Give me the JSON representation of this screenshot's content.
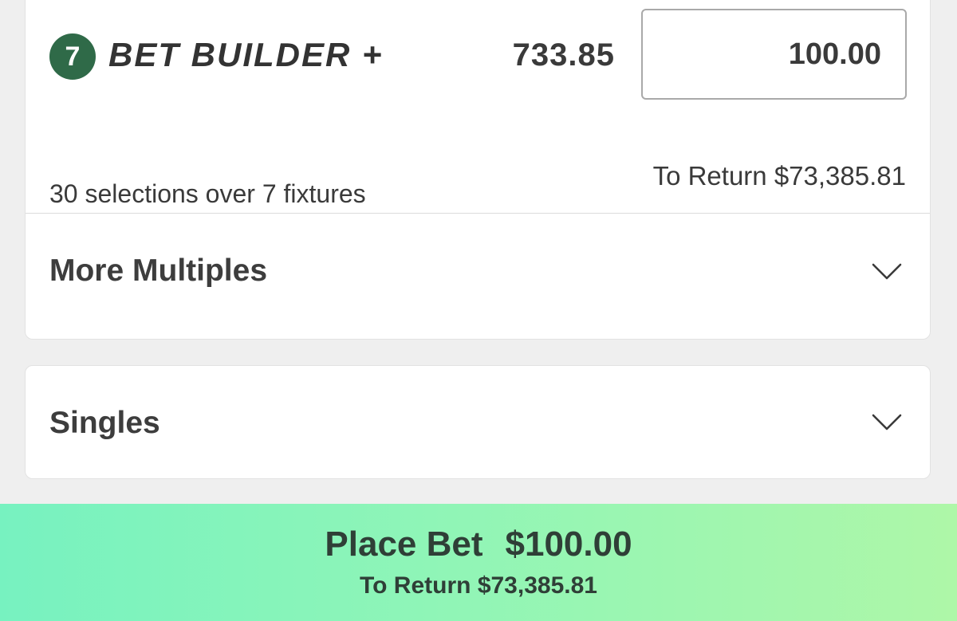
{
  "bet_builder": {
    "badge_number": "7",
    "title": "BET BUILDER +",
    "odds": "733.85",
    "stake_value": "100.00",
    "to_return_label": "To Return",
    "to_return_value": "$73,385.81",
    "selections_text": "30 selections over 7 fixtures"
  },
  "sections": {
    "more_multiples": "More Multiples",
    "singles": "Singles"
  },
  "place_bet": {
    "label": "Place Bet",
    "amount": "$100.00",
    "to_return_label": "To Return",
    "to_return_value": "$73,385.81"
  },
  "icons": {
    "expand": "chevron-down-icon"
  },
  "colors": {
    "badge": "#2f6a48",
    "place_bet_start": "#77f2c0",
    "place_bet_end": "#aef7a8",
    "page_background": "#efefef"
  }
}
